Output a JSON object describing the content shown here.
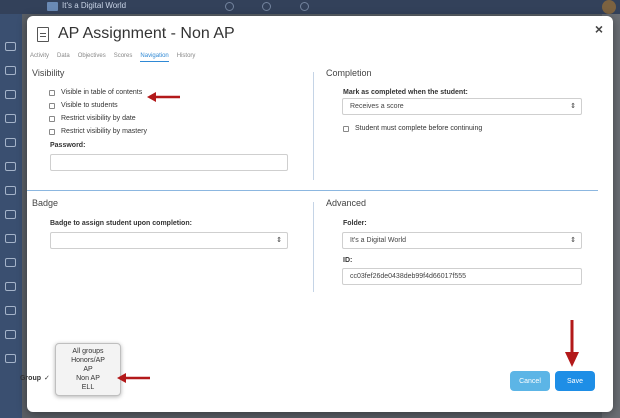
{
  "background": {
    "app_title": "It's a Digital World"
  },
  "modal": {
    "title": "AP Assignment - Non AP",
    "close_glyph": "×",
    "tabs": [
      {
        "label": "Activity"
      },
      {
        "label": "Data"
      },
      {
        "label": "Objectives"
      },
      {
        "label": "Scores"
      },
      {
        "label": "Navigation",
        "active": true
      },
      {
        "label": "History"
      }
    ],
    "visibility": {
      "title": "Visibility",
      "options": [
        {
          "label": "Visible in table of contents"
        },
        {
          "label": "Visible to students"
        },
        {
          "label": "Restrict visibility by date"
        },
        {
          "label": "Restrict visibility by mastery"
        }
      ],
      "password_label": "Password:",
      "password_value": ""
    },
    "completion": {
      "title": "Completion",
      "mark_label": "Mark as completed when the student:",
      "mark_value": "Receives a score",
      "must_complete_label": "Student must complete before continuing"
    },
    "badge": {
      "title": "Badge",
      "assign_label": "Badge to assign student upon completion:",
      "assign_value": ""
    },
    "advanced": {
      "title": "Advanced",
      "folder_label": "Folder:",
      "folder_value": "It's a Digital World",
      "id_label": "ID:",
      "id_value": "cc03fef26de0438deb99f4d66017f555"
    },
    "footer": {
      "group_label": "Group",
      "group_options": [
        "All groups",
        "Honors/AP",
        "AP",
        "Non AP",
        "ELL"
      ],
      "group_selected": "Non AP",
      "checkmark": "✓",
      "cancel_label": "Cancel",
      "save_label": "Save"
    }
  },
  "colors": {
    "accent": "#2f89d5",
    "save": "#1e8ee6",
    "cancel": "#5cb5e6",
    "annotation_arrow": "#b3191a"
  },
  "icons": {
    "title_icon": "document-icon",
    "select_chevron": "updown-chevron-icon",
    "close": "close-icon"
  }
}
